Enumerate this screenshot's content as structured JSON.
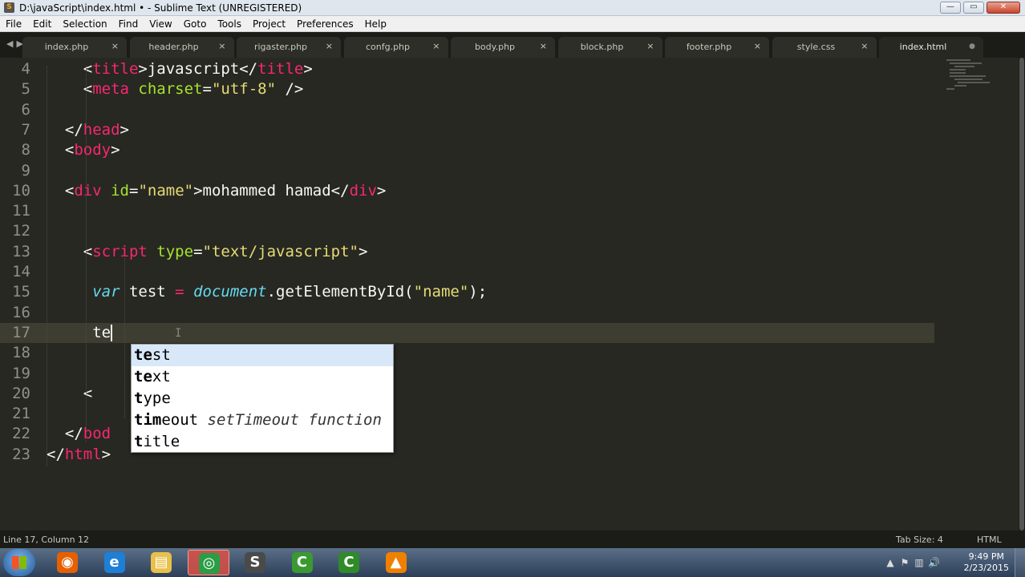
{
  "window": {
    "title": "D:\\javaScript\\index.html • - Sublime Text (UNREGISTERED)",
    "app_icon": "S",
    "controls": {
      "minimize": "—",
      "maximize": "▭",
      "close": "✕"
    }
  },
  "menu": [
    "File",
    "Edit",
    "Selection",
    "Find",
    "View",
    "Goto",
    "Tools",
    "Project",
    "Preferences",
    "Help"
  ],
  "tabs": {
    "nav_arrows": "◀▶",
    "close_glyph": "×",
    "active_glyph": "●",
    "items": [
      {
        "label": "index.php",
        "active": false
      },
      {
        "label": "header.php",
        "active": false
      },
      {
        "label": "rigaster.php",
        "active": false
      },
      {
        "label": "confg.php",
        "active": false
      },
      {
        "label": "body.php",
        "active": false
      },
      {
        "label": "block.php",
        "active": false
      },
      {
        "label": "footer.php",
        "active": false
      },
      {
        "label": "style.css",
        "active": false
      },
      {
        "label": "index.html",
        "active": true
      }
    ]
  },
  "editor": {
    "current_line": 17,
    "lines": [
      {
        "n": "4",
        "tokens": [
          {
            "t": "    <",
            "c": "p"
          },
          {
            "t": "title",
            "c": "tag"
          },
          {
            "t": ">javascript</",
            "c": "p"
          },
          {
            "t": "title",
            "c": "tag"
          },
          {
            "t": ">",
            "c": "p"
          }
        ]
      },
      {
        "n": "5",
        "tokens": [
          {
            "t": "    <",
            "c": "p"
          },
          {
            "t": "meta",
            "c": "tag"
          },
          {
            "t": " ",
            "c": "p"
          },
          {
            "t": "charset",
            "c": "attr"
          },
          {
            "t": "=",
            "c": "p"
          },
          {
            "t": "\"utf-8\"",
            "c": "str"
          },
          {
            "t": " />",
            "c": "p"
          }
        ]
      },
      {
        "n": "6",
        "tokens": []
      },
      {
        "n": "7",
        "tokens": [
          {
            "t": "  </",
            "c": "p"
          },
          {
            "t": "head",
            "c": "tag"
          },
          {
            "t": ">",
            "c": "p"
          }
        ]
      },
      {
        "n": "8",
        "tokens": [
          {
            "t": "  <",
            "c": "p"
          },
          {
            "t": "body",
            "c": "tag"
          },
          {
            "t": ">",
            "c": "p"
          }
        ]
      },
      {
        "n": "9",
        "tokens": []
      },
      {
        "n": "10",
        "tokens": [
          {
            "t": "  <",
            "c": "p"
          },
          {
            "t": "div",
            "c": "tag"
          },
          {
            "t": " ",
            "c": "p"
          },
          {
            "t": "id",
            "c": "attr"
          },
          {
            "t": "=",
            "c": "p"
          },
          {
            "t": "\"name\"",
            "c": "str"
          },
          {
            "t": ">mohammed hamad</",
            "c": "p"
          },
          {
            "t": "div",
            "c": "tag"
          },
          {
            "t": ">",
            "c": "p"
          }
        ]
      },
      {
        "n": "11",
        "tokens": []
      },
      {
        "n": "12",
        "tokens": []
      },
      {
        "n": "13",
        "tokens": [
          {
            "t": "    <",
            "c": "p"
          },
          {
            "t": "script",
            "c": "tag"
          },
          {
            "t": " ",
            "c": "p"
          },
          {
            "t": "type",
            "c": "attr"
          },
          {
            "t": "=",
            "c": "p"
          },
          {
            "t": "\"text/javascript\"",
            "c": "str"
          },
          {
            "t": ">",
            "c": "p"
          }
        ]
      },
      {
        "n": "14",
        "tokens": []
      },
      {
        "n": "15",
        "tokens": [
          {
            "t": "     ",
            "c": "p"
          },
          {
            "t": "var",
            "c": "kw"
          },
          {
            "t": " test ",
            "c": "p"
          },
          {
            "t": "=",
            "c": "op"
          },
          {
            "t": " ",
            "c": "p"
          },
          {
            "t": "document",
            "c": "kw"
          },
          {
            "t": ".getElementById(",
            "c": "p"
          },
          {
            "t": "\"name\"",
            "c": "str"
          },
          {
            "t": ");",
            "c": "p"
          }
        ]
      },
      {
        "n": "16",
        "tokens": []
      },
      {
        "n": "17",
        "tokens": [
          {
            "t": "     te",
            "c": "p"
          }
        ]
      },
      {
        "n": "18",
        "tokens": []
      },
      {
        "n": "19",
        "tokens": []
      },
      {
        "n": "20",
        "tokens": [
          {
            "t": "    <",
            "c": "p"
          }
        ]
      },
      {
        "n": "21",
        "tokens": []
      },
      {
        "n": "22",
        "tokens": [
          {
            "t": "  </",
            "c": "p"
          },
          {
            "t": "bod",
            "c": "tag"
          }
        ]
      },
      {
        "n": "23",
        "tokens": [
          {
            "t": "</",
            "c": "p"
          },
          {
            "t": "html",
            "c": "tag"
          },
          {
            "t": ">",
            "c": "p"
          }
        ]
      }
    ]
  },
  "autocomplete": {
    "items": [
      {
        "match": "te",
        "rest": "st",
        "hint": "",
        "selected": true
      },
      {
        "match": "te",
        "rest": "xt",
        "hint": "",
        "selected": false
      },
      {
        "match": "t",
        "rest": "ype",
        "hint": "",
        "selected": false
      },
      {
        "match": "tim",
        "rest": "eout",
        "hint": "setTimeout function",
        "selected": false
      },
      {
        "match": "t",
        "rest": "itle",
        "hint": "",
        "selected": false
      }
    ]
  },
  "status": {
    "position": "Line 17, Column 12",
    "tab_size": "Tab Size: 4",
    "syntax": "HTML"
  },
  "taskbar": {
    "apps": [
      {
        "name": "firefox",
        "glyph": "◉",
        "color": "#e66000",
        "active": false
      },
      {
        "name": "internet-explorer",
        "glyph": "e",
        "color": "#1e7fd6",
        "active": false
      },
      {
        "name": "file-explorer",
        "glyph": "▤",
        "color": "#e8c04a",
        "active": false
      },
      {
        "name": "chrome",
        "glyph": "◎",
        "color": "#2a9d45",
        "active": true
      },
      {
        "name": "sublime-text",
        "glyph": "S",
        "color": "#4a4a4a",
        "active": false
      },
      {
        "name": "camtasia",
        "glyph": "C",
        "color": "#3a9a30",
        "active": false
      },
      {
        "name": "camtasia-recorder",
        "glyph": "C",
        "color": "#2f8a28",
        "active": false
      },
      {
        "name": "vlc",
        "glyph": "▲",
        "color": "#f08000",
        "active": false
      }
    ],
    "tray": [
      "▲",
      "⚑",
      "▥",
      "🔊"
    ],
    "time": "9:49 PM",
    "date": "2/23/2015"
  }
}
